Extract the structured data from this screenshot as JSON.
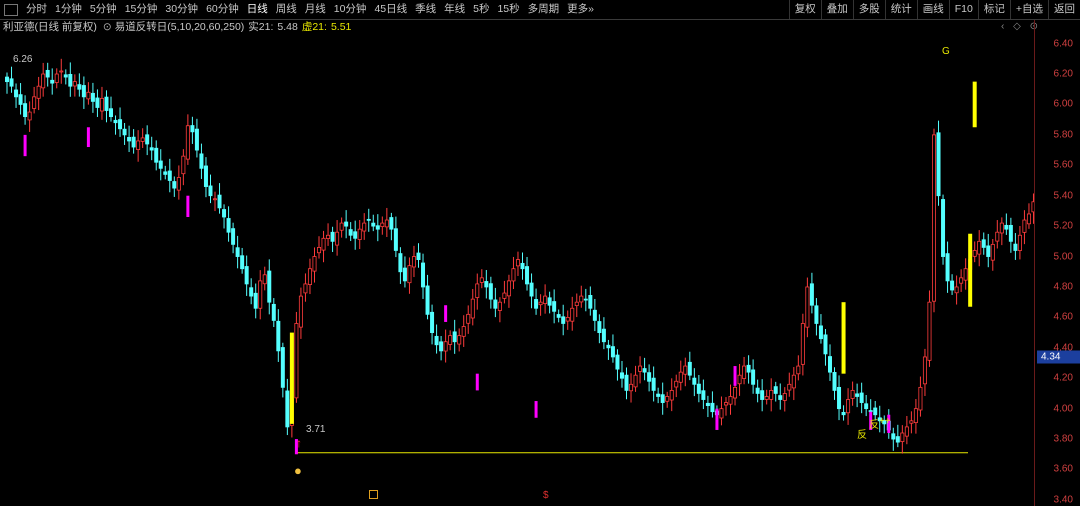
{
  "toolbar": {
    "timeframes": [
      "分时",
      "1分钟",
      "5分钟",
      "15分钟",
      "30分钟",
      "60分钟",
      "日线",
      "周线",
      "月线",
      "10分钟",
      "45日线",
      "季线",
      "年线",
      "5秒",
      "15秒",
      "多周期",
      "更多»"
    ],
    "active": "日线",
    "tools": [
      "复权",
      "叠加",
      "多股",
      "统计",
      "画线",
      "F10",
      "标记",
      "+自选",
      "返回"
    ]
  },
  "info": {
    "stock": "利亚德(日线 前复权)",
    "indicator": "易道反转日(5,10,20,60,250)",
    "real_label": "实21:",
    "real_value": "5.48",
    "virtual_label": "虚21:",
    "virtual_value": "5.51"
  },
  "annotations": {
    "high_label": "6.26",
    "low_label": "3.71",
    "g_label": "G",
    "fan_label": "反",
    "fan2_label": "反",
    "plus_label": "++"
  },
  "colors": {
    "up": "#ff3c3c",
    "down": "#54ffff",
    "signal_yellow": "#ffff00",
    "signal_magenta": "#ff00ff",
    "signal_green": "#00ff00",
    "support_line": "#e8e800",
    "axis_text": "#d04040",
    "last_price_bg": "#1c3f9e"
  },
  "chart_data": {
    "type": "candlestick",
    "y_ticks": [
      6.4,
      6.2,
      6.0,
      5.8,
      5.6,
      5.4,
      5.2,
      5.0,
      4.8,
      4.6,
      4.4,
      4.2,
      4.0,
      3.8,
      3.6,
      3.4
    ],
    "ylim": [
      3.36,
      6.45
    ],
    "last_price": 4.34,
    "support_level": 3.71,
    "close": [
      6.15,
      6.12,
      6.05,
      6.0,
      5.92,
      5.95,
      6.05,
      6.12,
      6.2,
      6.18,
      6.14,
      6.2,
      6.22,
      6.18,
      6.12,
      6.15,
      6.1,
      6.05,
      6.08,
      6.02,
      5.98,
      6.04,
      5.96,
      5.92,
      5.88,
      5.84,
      5.8,
      5.76,
      5.72,
      5.76,
      5.78,
      5.74,
      5.7,
      5.62,
      5.58,
      5.54,
      5.5,
      5.45,
      5.52,
      5.66,
      5.86,
      5.82,
      5.7,
      5.58,
      5.46,
      5.4,
      5.38,
      5.32,
      5.26,
      5.16,
      5.08,
      5.0,
      4.92,
      4.82,
      4.74,
      4.66,
      4.84,
      4.88,
      4.7,
      4.58,
      4.38,
      4.14,
      3.88,
      4.06,
      4.56,
      4.74,
      4.82,
      4.92,
      5.0,
      5.06,
      5.12,
      5.14,
      5.1,
      5.16,
      5.22,
      5.2,
      5.14,
      5.12,
      5.18,
      5.22,
      5.24,
      5.2,
      5.18,
      5.22,
      5.24,
      5.18,
      5.04,
      4.9,
      4.84,
      4.94,
      5.0,
      4.98,
      4.8,
      4.62,
      4.5,
      4.42,
      4.38,
      4.44,
      4.48,
      4.44,
      4.48,
      4.54,
      4.62,
      4.72,
      4.82,
      4.86,
      4.8,
      4.72,
      4.66,
      4.7,
      4.76,
      4.84,
      4.92,
      4.98,
      4.92,
      4.82,
      4.74,
      4.66,
      4.7,
      4.74,
      4.68,
      4.64,
      4.6,
      4.56,
      4.6,
      4.66,
      4.7,
      4.74,
      4.72,
      4.66,
      4.58,
      4.5,
      4.44,
      4.4,
      4.34,
      4.26,
      4.2,
      4.12,
      4.16,
      4.22,
      4.28,
      4.24,
      4.18,
      4.12,
      4.08,
      4.04,
      4.08,
      4.12,
      4.18,
      4.24,
      4.28,
      4.22,
      4.16,
      4.1,
      4.06,
      4.02,
      3.98,
      3.96,
      4.0,
      4.04,
      4.08,
      4.14,
      4.22,
      4.28,
      4.24,
      4.16,
      4.1,
      4.06,
      4.08,
      4.12,
      4.1,
      4.06,
      4.1,
      4.16,
      4.22,
      4.28,
      4.56,
      4.8,
      4.68,
      4.56,
      4.46,
      4.36,
      4.24,
      4.12,
      4.0,
      3.96,
      4.06,
      4.12,
      4.08,
      4.04,
      4.0,
      3.98,
      3.96,
      3.92,
      3.9,
      3.86,
      3.8,
      3.78,
      3.84,
      3.88,
      3.92,
      4.0,
      4.14,
      4.34,
      4.7,
      5.8,
      5.4,
      5.0,
      4.84,
      4.78,
      4.8,
      4.86,
      4.92,
      4.98,
      5.04,
      5.1,
      5.06,
      5.0,
      5.08,
      5.16,
      5.22,
      5.18,
      5.1,
      5.04,
      5.14,
      5.24,
      5.28,
      5.36,
      5.48
    ]
  }
}
